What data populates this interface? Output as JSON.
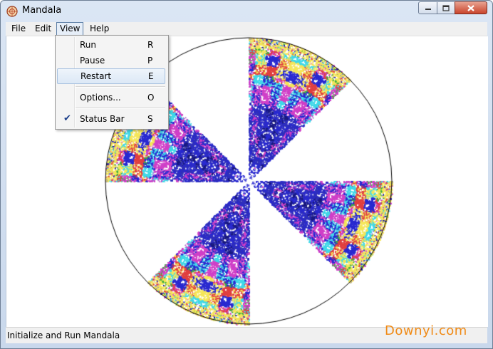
{
  "window": {
    "title": "Mandala",
    "icon": "mandala-app-icon"
  },
  "menubar": {
    "items": [
      "File",
      "Edit",
      "View",
      "Help"
    ]
  },
  "view_menu": {
    "items": [
      {
        "label": "Run",
        "shortcut": "R"
      },
      {
        "label": "Pause",
        "shortcut": "P"
      },
      {
        "label": "Restart",
        "shortcut": "E"
      },
      {
        "label": "Options...",
        "shortcut": "O"
      },
      {
        "label": "Status Bar",
        "shortcut": "S",
        "checked": true
      }
    ],
    "highlighted": "Restart",
    "check_icon": "checkmark-icon"
  },
  "status": {
    "text": "Initialize and Run Mandala"
  },
  "watermark": {
    "text": "Downyi.com"
  },
  "colors": {
    "accent_blue": "#2a2ad0",
    "cyan": "#40d8e8",
    "magenta": "#d040c8",
    "yellow": "#f5e65a",
    "green": "#40b040",
    "watermark_orange": "#f08a15"
  }
}
